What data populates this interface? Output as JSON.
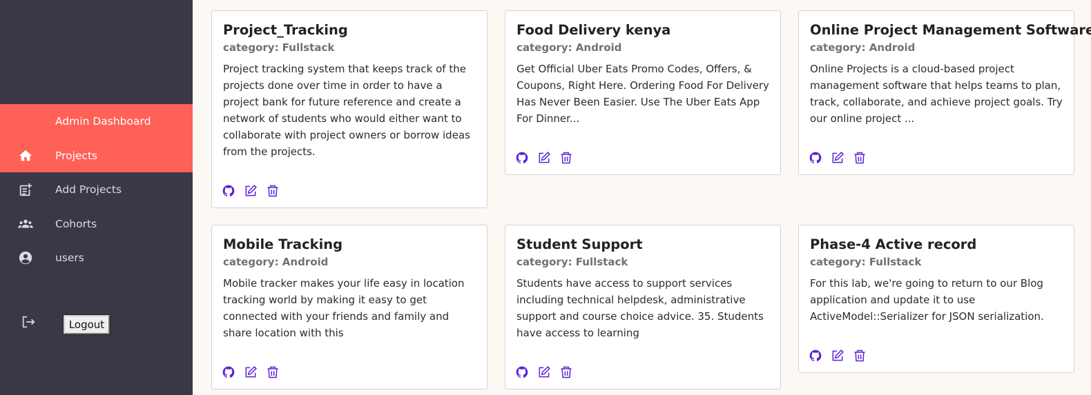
{
  "sidebar": {
    "items": [
      {
        "label": "Admin Dashboard",
        "icon": "none",
        "active": false
      },
      {
        "label": "Projects",
        "icon": "home-icon",
        "active": true
      },
      {
        "label": "Add Projects",
        "icon": "add-note-icon",
        "active": false
      },
      {
        "label": "Cohorts",
        "icon": "group-icon",
        "active": false
      },
      {
        "label": "users",
        "icon": "user-circle-icon",
        "active": false
      }
    ],
    "logout_label": "Logout",
    "logout_icon": "logout-icon"
  },
  "colors": {
    "sidebar_bg": "#3a3746",
    "active_bg": "#ff6157",
    "icon_accent": "#5b21d8",
    "page_bg": "#fcf9f4"
  },
  "projects": [
    {
      "title": "Project_Tracking",
      "category": "category: Fullstack",
      "description": "Project tracking system that keeps track of the projects done over time in order to have a project bank for future reference and create a network of students who would either want to collaborate with project owners or borrow ideas from the projects."
    },
    {
      "title": "Food Delivery kenya",
      "category": "category: Android",
      "description": "Get Official Uber Eats Promo Codes, Offers, & Coupons, Right Here. Ordering Food For Delivery Has Never Been Easier. Use The Uber Eats App For Dinner..."
    },
    {
      "title": "Online Project Management Software",
      "category": "category: Android",
      "description": "Online Projects is a cloud-based project management software that helps teams to plan, track, collaborate, and achieve project goals. Try our online project ..."
    },
    {
      "title": "Mobile Tracking",
      "category": "category: Android",
      "description": "Mobile tracker makes your life easy in location tracking world by making it easy to get connected with your friends and family and share location with this"
    },
    {
      "title": "Student Support",
      "category": "category: Fullstack",
      "description": "Students have access to support services including technical helpdesk, administrative support and course choice advice. 35. Students have access to learning"
    },
    {
      "title": "Phase-4 Active record",
      "category": "category: Fullstack",
      "description": "For this lab, we're going to return to our Blog application and update it to use ActiveModel::Serializer for JSON serialization."
    }
  ],
  "card_action_icons": [
    "github-icon",
    "edit-icon",
    "trash-icon"
  ]
}
